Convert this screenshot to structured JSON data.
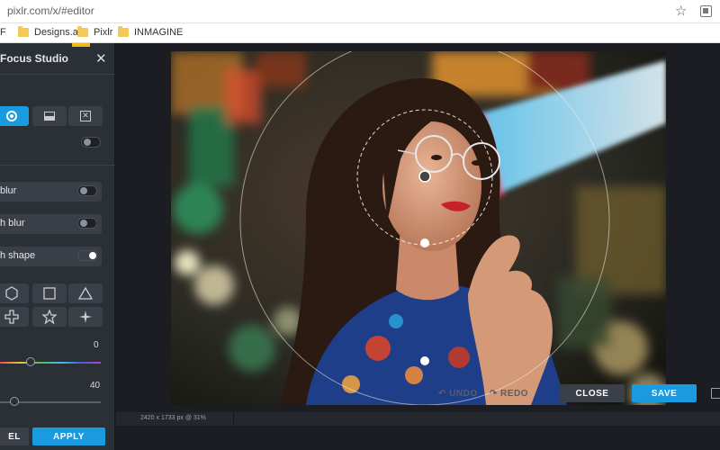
{
  "browser": {
    "url": "pixlr.com/x/#editor",
    "bookmarks": [
      {
        "label": "F"
      },
      {
        "label": "Designs.ai"
      },
      {
        "label": "Pixlr"
      },
      {
        "label": "INMAGINE"
      }
    ]
  },
  "panel": {
    "title": "Focus Studio",
    "options": [
      {
        "label": "blur",
        "on": false
      },
      {
        "label": "h blur",
        "on": false
      },
      {
        "label": "h shape",
        "on": true
      }
    ],
    "shapes": [
      "hexagon-icon",
      "square-icon",
      "triangle-icon",
      "cross-icon",
      "star-icon",
      "sparkle-icon"
    ],
    "slider1": {
      "value": "0",
      "level": 0.3
    },
    "slider2": {
      "value": "40",
      "level": 0.14
    },
    "cancel_label": "EL",
    "apply_label": "APPLY"
  },
  "canvas": {
    "status": "2420 x 1733 px @ 31%"
  },
  "toolbar": {
    "undo_label": "↶ UNDO",
    "redo_label": "↷ REDO",
    "close_label": "CLOSE",
    "save_label": "SAVE"
  },
  "colors": {
    "accent": "#1a9be0",
    "panel": "#2b2f36",
    "background": "#1b1d22"
  }
}
